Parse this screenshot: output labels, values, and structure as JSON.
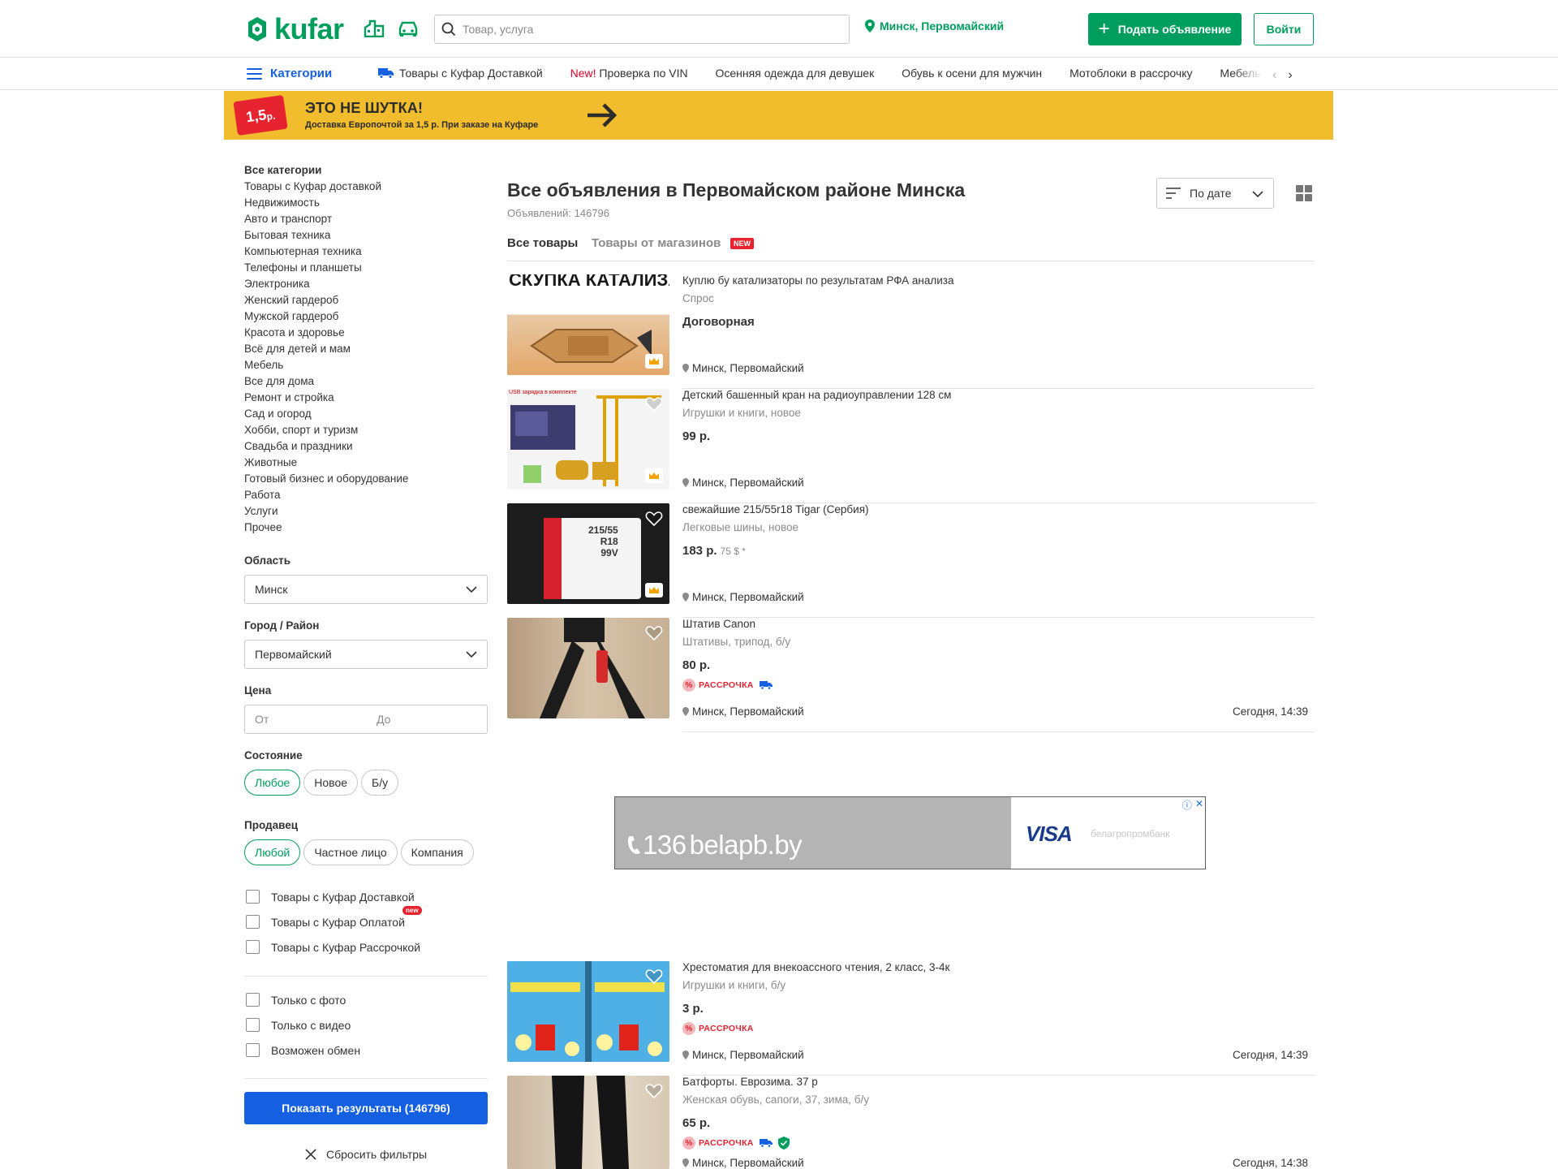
{
  "header": {
    "logo_text": "kufar",
    "search_placeholder": "Товар, услуга",
    "location": "Минск, Первомайский",
    "post_button": "Подать объявление",
    "login_button": "Войти",
    "brand_color": "#009e5e"
  },
  "nav": {
    "categories_label": "Категории",
    "links": [
      {
        "label": "Товары с Куфар Доставкой",
        "icon": "delivery-truck-icon"
      },
      {
        "prefix": "New!",
        "label": "Проверка по VIN"
      },
      {
        "label": "Осенняя одежда для девушек"
      },
      {
        "label": "Обувь к осени для мужчин"
      },
      {
        "label": "Мотоблоки в рассрочку"
      },
      {
        "label": "Мебель с"
      }
    ]
  },
  "banner": {
    "price_tag": "1,5",
    "price_unit": "р.",
    "title": "ЭТО НЕ ШУТКА!",
    "subtitle": "Доставка Европочтой за 1,5 р. При заказе на Куфаре"
  },
  "sidebar": {
    "categories": [
      "Все категории",
      "Товары с Куфар доставкой",
      "Недвижимость",
      "Авто и транспорт",
      "Бытовая техника",
      "Компьютерная техника",
      "Телефоны и планшеты",
      "Электроника",
      "Женский гардероб",
      "Мужской гардероб",
      "Красота и здоровье",
      "Всё для детей и мам",
      "Мебель",
      "Все для дома",
      "Ремонт и стройка",
      "Сад и огород",
      "Хобби, спорт и туризм",
      "Свадьба и праздники",
      "Животные",
      "Готовый бизнес и оборудование",
      "Работа",
      "Услуги",
      "Прочее"
    ],
    "region_label": "Область",
    "region_value": "Минск",
    "city_label": "Город / Район",
    "city_value": "Первомайский",
    "price_label": "Цена",
    "price_from_placeholder": "От",
    "price_to_placeholder": "До",
    "condition_label": "Состояние",
    "condition_options": [
      "Любое",
      "Новое",
      "Б/у"
    ],
    "seller_label": "Продавец",
    "seller_options": [
      "Любой",
      "Частное лицо",
      "Компания"
    ],
    "checks_group1": [
      "Товары с Куфар Доставкой",
      "Товары с Куфар Оплатой",
      "Товары с Куфар Рассрочкой"
    ],
    "new_tag": "new",
    "checks_group2": [
      "Только с фото",
      "Только с видео",
      "Возможен обмен"
    ],
    "show_results_button": "Показать результаты (146796)",
    "reset_button": "Сбросить фильтры"
  },
  "main": {
    "title": "Все объявления в Первомайском районе Минска",
    "count": "Объявлений: 146796",
    "sort_label": "По дате",
    "tabs": [
      {
        "label": "Все товары",
        "active": true
      },
      {
        "label": "Товары от магазинов",
        "active": false,
        "badge": "NEW"
      }
    ],
    "listings": [
      {
        "title": "Куплю бу катализаторы по результатам РФА анализа",
        "subtitle": "Спрос",
        "price": "Договорная",
        "location": "Минск, Первомайский",
        "date": "",
        "image_text": "СКУПКА КАТАЛИЗАТОРОВ",
        "icon": "crown-icon"
      },
      {
        "title": "Детский башенный кран на радиоуправлении 128 см",
        "subtitle": "Игрушки и книги, новое",
        "price": "99 р.",
        "location": "Минск, Первомайский",
        "date": "",
        "image_text": "USB зарядка в комплекте",
        "icon": "crown-icon"
      },
      {
        "title": "свежайшие 215/55r18 Tigar (Сербия)",
        "subtitle": "Легковые шины, новое",
        "price": "183 р.",
        "price_usd": "75 $ *",
        "location": "Минск, Первомайский",
        "date": "",
        "image_lines": [
          "215/55",
          "R18",
          "99V"
        ],
        "icon": "crown-icon"
      },
      {
        "title": "Штатив Canon",
        "subtitle": "Штативы, трипод, б/у",
        "price": "80 р.",
        "installment": "РАССРОЧКА",
        "location": "Минск, Первомайский",
        "date": "Сегодня, 14:39"
      },
      {
        "title": "Хрестоматия для внекоассного чтения, 2 класс, 3-4к",
        "subtitle": "Игрушки и книги, б/у",
        "price": "3 р.",
        "installment": "РАССРОЧКА",
        "location": "Минск, Первомайский",
        "date": "Сегодня, 14:39"
      },
      {
        "title": "Батфорты. Еврозима. 37 р",
        "subtitle": "Женская обувь, сапоги, 37, зима, б/у",
        "price": "65 р.",
        "installment": "РАССРОЧКА",
        "location": "Минск, Первомайский",
        "date": "Сегодня, 14:38"
      }
    ]
  },
  "ad": {
    "phone": "136",
    "site": "belapb.by",
    "visa": "VISA",
    "bank": "белагропромбанк"
  }
}
